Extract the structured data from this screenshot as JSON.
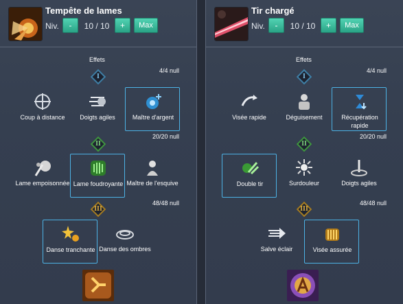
{
  "window": {
    "level_label": "Niv.",
    "minus": "-",
    "plus": "+",
    "max": "Max"
  },
  "left": {
    "title": "Tempête de lames",
    "level": "10 / 10",
    "effects_label": "Effets",
    "tiers": [
      "I",
      "II",
      "III"
    ],
    "counts": [
      "4/4 null",
      "20/20 null",
      "48/48 null"
    ],
    "tier1": [
      "Coup à distance",
      "Doigts agiles",
      "Maître d'argent"
    ],
    "tier2": [
      "Lame empoisonnée",
      "Lame foudroyante",
      "Maître de l'esquive"
    ],
    "tier3": [
      "Danse tranchante",
      "Danse des ombres"
    ]
  },
  "right": {
    "title": "Tir chargé",
    "level": "10 / 10",
    "effects_label": "Effets",
    "tiers": [
      "I",
      "II",
      "III"
    ],
    "counts": [
      "4/4 null",
      "20/20 null",
      "48/48 null"
    ],
    "tier1": [
      "Visée rapide",
      "Déguisement",
      "Récupération rapide"
    ],
    "tier2": [
      "Double tir",
      "Surdouleur",
      "Doigts agiles"
    ],
    "tier3": [
      "Salve éclair",
      "Visée assurée"
    ]
  }
}
